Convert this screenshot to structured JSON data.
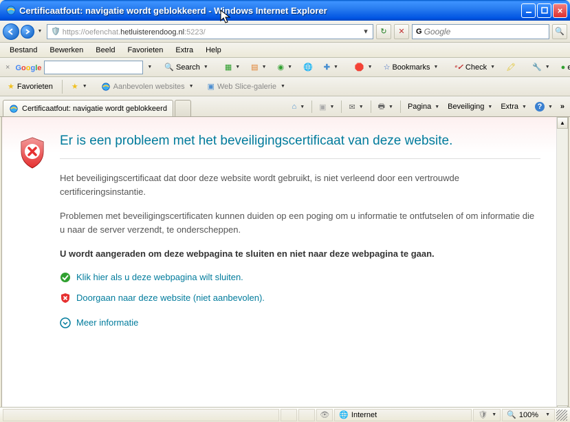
{
  "window": {
    "title": "Certificaatfout: navigatie wordt geblokkeerd - Windows Internet Explorer"
  },
  "nav": {
    "url_prefix": "https://oefenchat.",
    "url_host": "hetluisterendoog.nl",
    "url_suffix": ":5223/",
    "search_placeholder": "Google"
  },
  "menu": {
    "bestand": "Bestand",
    "bewerken": "Bewerken",
    "beeld": "Beeld",
    "favorieten": "Favorieten",
    "extra": "Extra",
    "help": "Help"
  },
  "gbar": {
    "brand": "Google",
    "search": "Search",
    "bookmarks": "Bookmarks",
    "check": "Check",
    "user": "e.herz..."
  },
  "favbar": {
    "favorites": "Favorieten",
    "suggested": "Aanbevolen websites",
    "slice": "Web Slice-galerie"
  },
  "tab": {
    "title": "Certificaatfout: navigatie wordt geblokkeerd"
  },
  "cmd": {
    "page": "Pagina",
    "security": "Beveiliging",
    "extra": "Extra"
  },
  "cert": {
    "heading": "Er is een probleem met het beveiligingscertificaat van deze website.",
    "p1": "Het beveiligingscertificaat dat door deze website wordt gebruikt, is niet verleend door een vertrouwde certificeringsinstantie.",
    "p2": "Problemen met beveiligingscertificaten kunnen duiden op een poging om u informatie te ontfutselen of om informatie die u naar de server verzendt, te onderscheppen.",
    "p3": "U wordt aangeraden om deze webpagina te sluiten en niet naar deze webpagina te gaan.",
    "close_link": "Klik hier als u deze webpagina wilt sluiten.",
    "continue_link": "Doorgaan naar deze website (niet aanbevolen).",
    "more_info": "Meer informatie"
  },
  "status": {
    "zone": "Internet",
    "zoom": "100%"
  }
}
